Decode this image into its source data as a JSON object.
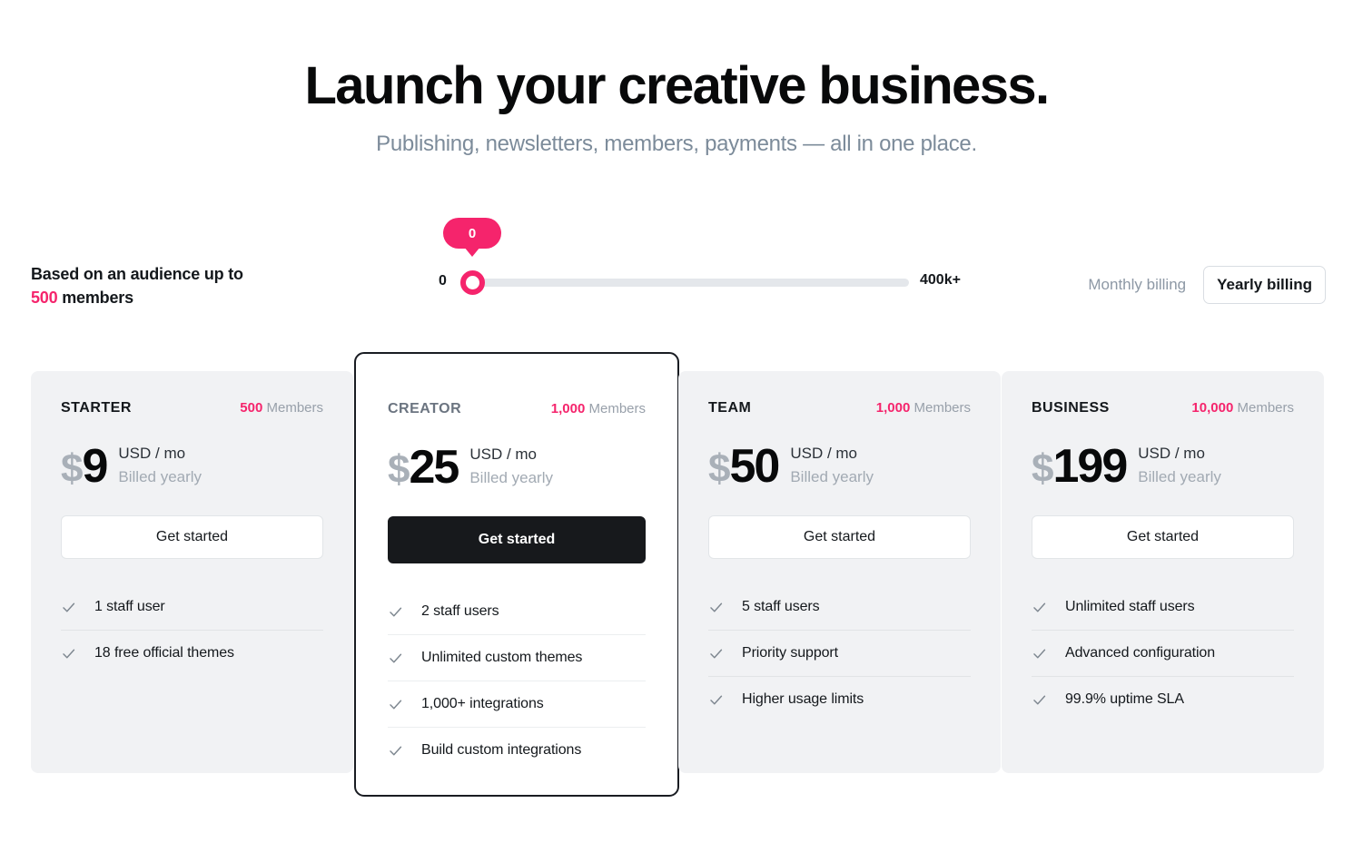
{
  "hero": {
    "title": "Launch your creative business.",
    "subtitle": "Publishing, newsletters, members, payments — all in one place."
  },
  "audience": {
    "prefix": "Based on an audience up to",
    "count": "500",
    "suffix": "members"
  },
  "slider": {
    "bubble_value": "0",
    "min_label": "0",
    "max_label": "400k+",
    "value": 0,
    "min": 0,
    "max": 400000
  },
  "billing": {
    "monthly_label": "Monthly billing",
    "yearly_label": "Yearly billing",
    "selected": "Yearly billing"
  },
  "colors": {
    "accent_pink": "#f5246c",
    "card_bg": "#f1f2f4",
    "featured_border": "#191c22",
    "dark_button": "#17191c"
  },
  "plans": [
    {
      "name": "STARTER",
      "members_count": "500",
      "members_label": "Members",
      "currency": "$",
      "price": "9",
      "unit": "USD / mo",
      "terms": "Billed yearly",
      "cta": "Get started",
      "featured": false,
      "features": [
        "1 staff user",
        "18 free official themes"
      ]
    },
    {
      "name": "CREATOR",
      "members_count": "1,000",
      "members_label": "Members",
      "currency": "$",
      "price": "25",
      "unit": "USD / mo",
      "terms": "Billed yearly",
      "cta": "Get started",
      "featured": true,
      "features": [
        "2 staff users",
        "Unlimited custom themes",
        "1,000+ integrations",
        "Build custom integrations"
      ]
    },
    {
      "name": "TEAM",
      "members_count": "1,000",
      "members_label": "Members",
      "currency": "$",
      "price": "50",
      "unit": "USD / mo",
      "terms": "Billed yearly",
      "cta": "Get started",
      "featured": false,
      "features": [
        "5 staff users",
        "Priority support",
        "Higher usage limits"
      ]
    },
    {
      "name": "BUSINESS",
      "members_count": "10,000",
      "members_label": "Members",
      "currency": "$",
      "price": "199",
      "unit": "USD / mo",
      "terms": "Billed yearly",
      "cta": "Get started",
      "featured": false,
      "features": [
        "Unlimited staff users",
        "Advanced configuration",
        "99.9% uptime SLA"
      ]
    }
  ]
}
